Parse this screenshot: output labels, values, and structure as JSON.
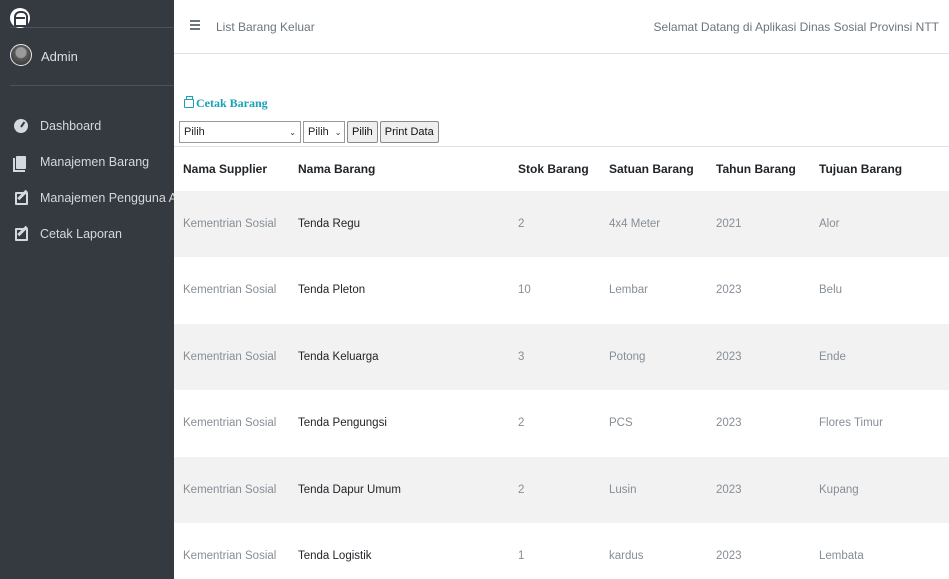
{
  "sidebar": {
    "user_name": "Admin",
    "items": [
      {
        "label": "Dashboard",
        "icon": "dashboard-icon"
      },
      {
        "label": "Manajemen Barang",
        "icon": "file-icon"
      },
      {
        "label": "Manajemen Pengguna Aplik",
        "icon": "edit-icon"
      },
      {
        "label": "Cetak Laporan",
        "icon": "edit-icon"
      }
    ]
  },
  "header": {
    "page_title": "List Barang Keluar",
    "welcome": "Selamat Datang di Aplikasi Dinas Sosial Provinsi NTT"
  },
  "toolbar": {
    "print_link": "Cetak Barang",
    "select_main": "Pilih",
    "select_small": "Pilih",
    "filter_button": "Pilih",
    "print_button": "Print Data"
  },
  "table": {
    "columns": [
      "Nama Supplier",
      "Nama Barang",
      "Stok Barang",
      "Satuan Barang",
      "Tahun Barang",
      "Tujuan Barang"
    ],
    "rows": [
      [
        "Kementrian Sosial",
        "Tenda Regu",
        "2",
        "4x4 Meter",
        "2021",
        "Alor"
      ],
      [
        "Kementrian Sosial",
        "Tenda Pleton",
        "10",
        "Lembar",
        "2023",
        "Belu"
      ],
      [
        "Kementrian Sosial",
        "Tenda Keluarga",
        "3",
        "Potong",
        "2023",
        "Ende"
      ],
      [
        "Kementrian Sosial",
        "Tenda Pengungsi",
        "2",
        "PCS",
        "2023",
        "Flores Timur"
      ],
      [
        "Kementrian Sosial",
        "Tenda Dapur Umum",
        "2",
        "Lusin",
        "2023",
        "Kupang"
      ],
      [
        "Kementrian Sosial",
        "Tenda Logistik",
        "1",
        "kardus",
        "2023",
        "Lembata"
      ]
    ]
  },
  "colors": {
    "sidebar_bg": "#343a40",
    "accent": "#17a2b8",
    "stripe": "#f2f2f2"
  }
}
